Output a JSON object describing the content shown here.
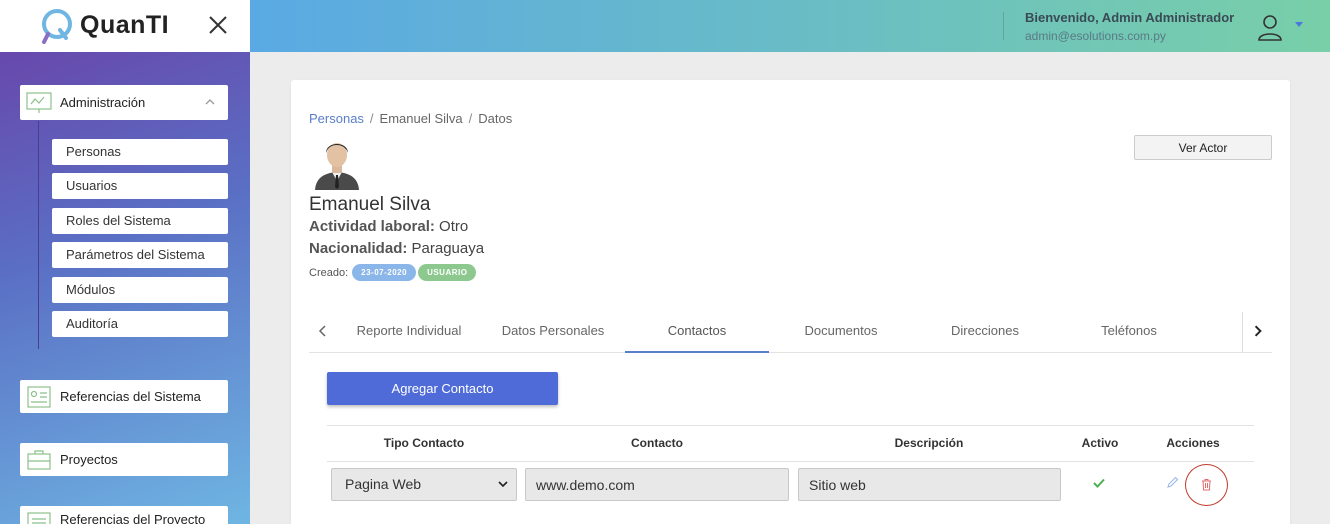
{
  "app": {
    "name": "QuanTI"
  },
  "header": {
    "welcome": "Bienvenido, Admin Administrador",
    "email": "admin@esolutions.com.py"
  },
  "sidebar": {
    "administracion": {
      "label": "Administración",
      "items": [
        "Personas",
        "Usuarios",
        "Roles del Sistema",
        "Parámetros del Sistema",
        "Módulos",
        "Auditoría"
      ]
    },
    "groups": [
      "Referencias del Sistema",
      "Proyectos",
      "Referencias del Proyecto"
    ]
  },
  "breadcrumb": [
    "Personas",
    "Emanuel Silva",
    "Datos"
  ],
  "actions": {
    "ver_actor": "Ver Actor",
    "agregar_contacto": "Agregar Contacto"
  },
  "person": {
    "name": "Emanuel Silva",
    "actividad_label": "Actividad laboral:",
    "actividad": "Otro",
    "nacionalidad_label": "Nacionalidad:",
    "nacionalidad": "Paraguaya",
    "creado_label": "Creado:",
    "creado_fecha": "23-07-2020",
    "rol": "USUARIO"
  },
  "tabs": [
    "Reporte Individual",
    "Datos Personales",
    "Contactos",
    "Documentos",
    "Direcciones",
    "Teléfonos"
  ],
  "active_tab": "Contactos",
  "table": {
    "headers": [
      "Tipo Contacto",
      "Contacto",
      "Descripción",
      "Activo",
      "Acciones"
    ],
    "rows": [
      {
        "tipo": "Pagina Web",
        "contacto": "www.demo.com",
        "descripcion": "Sitio web",
        "activo": true
      }
    ]
  },
  "colors": {
    "primary": "#4f6bd8",
    "link": "#5a7ec8",
    "active_check": "#4caf50",
    "delete": "#c0392b"
  }
}
